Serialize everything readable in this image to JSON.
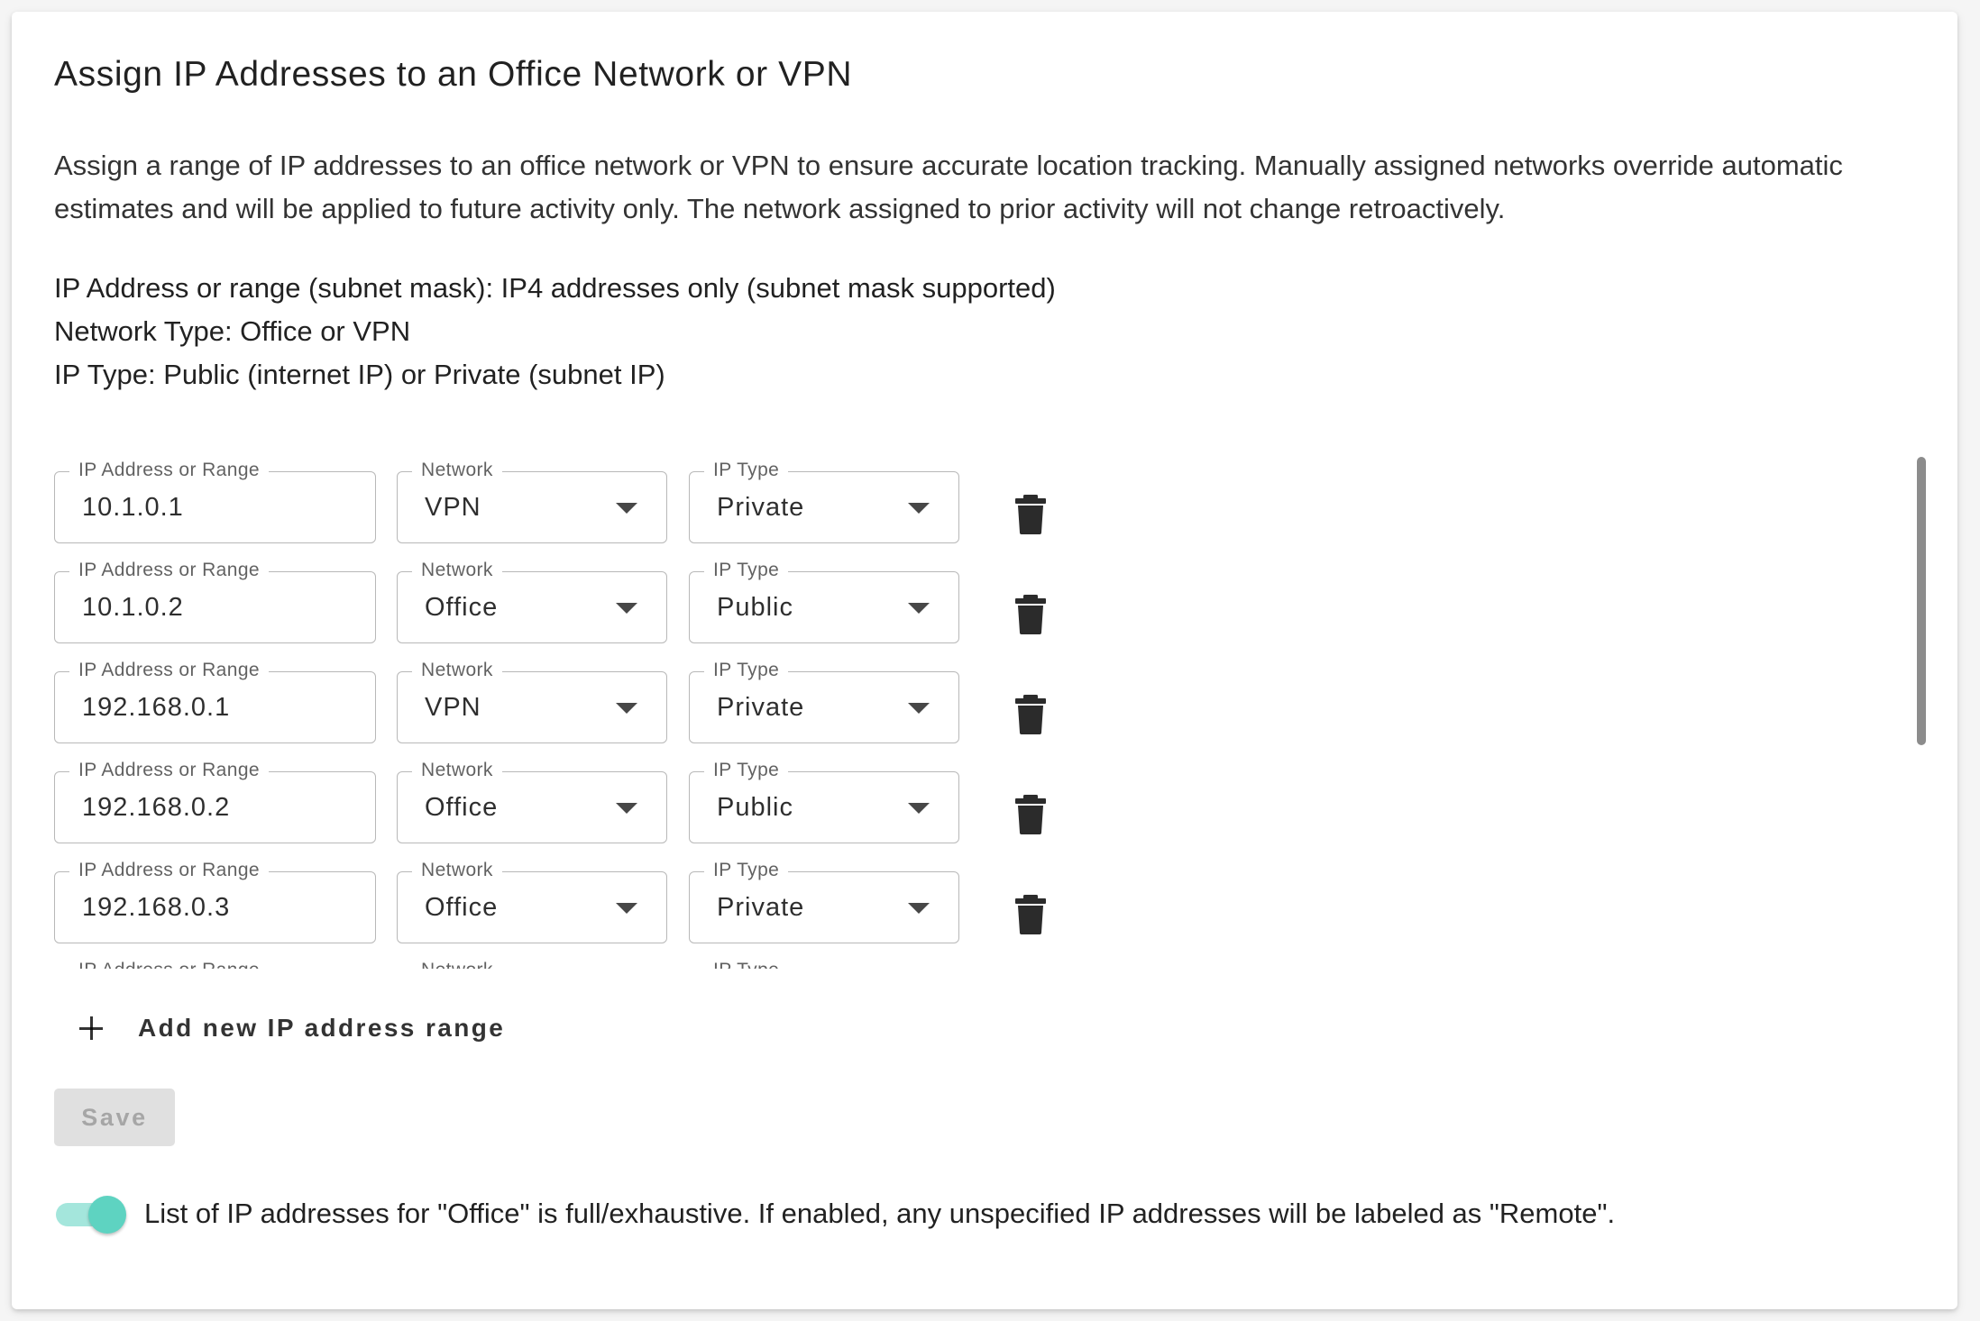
{
  "title": "Assign IP Addresses to an Office Network or VPN",
  "description": "Assign a range of IP addresses to an office network or VPN to ensure accurate location tracking. Manually assigned networks override automatic estimates and will be applied to future activity only. The network assigned to prior activity will not change retroactively.",
  "info_lines": [
    "IP Address or range (subnet mask): IP4 addresses only (subnet mask supported)",
    "Network Type: Office or VPN",
    "IP Type: Public (internet IP) or Private (subnet IP)"
  ],
  "field_labels": {
    "ip": "IP Address or Range",
    "network": "Network",
    "ip_type": "IP Type"
  },
  "rows": [
    {
      "ip": "10.1.0.1",
      "network": "VPN",
      "ip_type": "Private"
    },
    {
      "ip": "10.1.0.2",
      "network": "Office",
      "ip_type": "Public"
    },
    {
      "ip": "192.168.0.1",
      "network": "VPN",
      "ip_type": "Private"
    },
    {
      "ip": "192.168.0.2",
      "network": "Office",
      "ip_type": "Public"
    },
    {
      "ip": "192.168.0.3",
      "network": "Office",
      "ip_type": "Private"
    },
    {
      "ip": "",
      "network": "",
      "ip_type": ""
    }
  ],
  "icons": {
    "delete": "trash-icon",
    "add": "plus-icon",
    "dropdown": "caret-down-icon"
  },
  "add_button_label": "Add new IP address range",
  "save_button_label": "Save",
  "toggle": {
    "enabled": true,
    "label": "List of IP addresses for \"Office\" is full/exhaustive. If enabled, any unspecified IP addresses will be labeled as \"Remote\".",
    "accent_color": "#5ed3c1"
  }
}
